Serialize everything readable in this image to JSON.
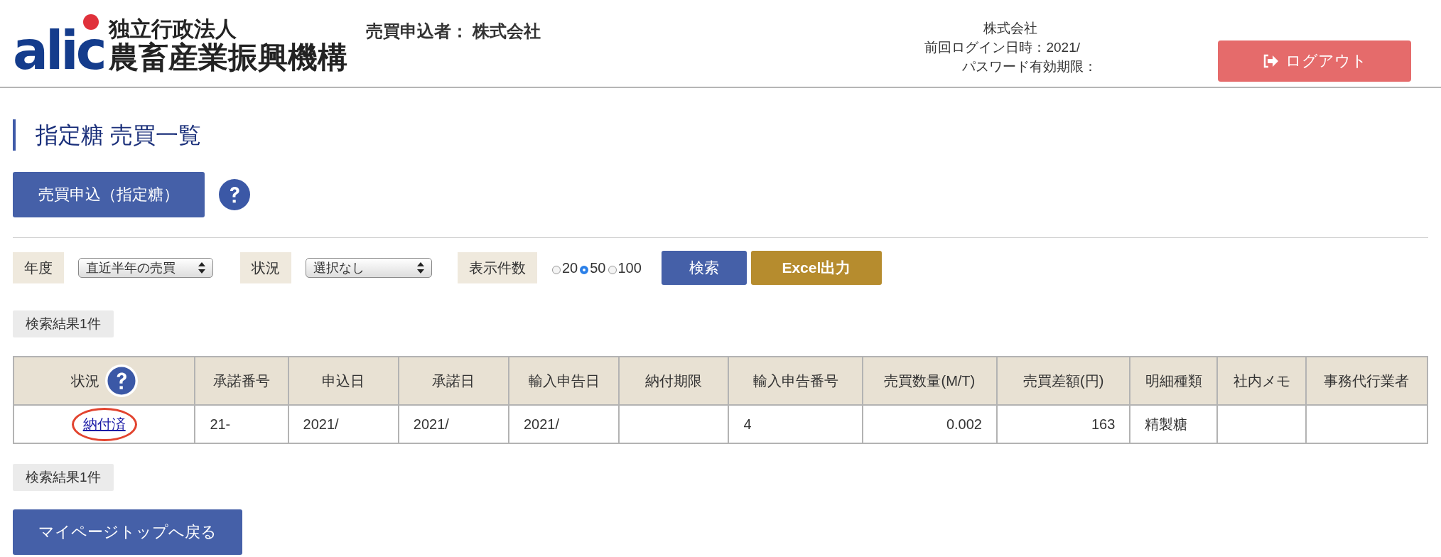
{
  "header": {
    "logo": {
      "mark": "alic",
      "line1": "独立行政法人",
      "line2": "農畜産業振興機構"
    },
    "applicant_label": "売買申込者：",
    "applicant_name": "株式会社",
    "company": "株式会社",
    "last_login": "前回ログイン日時：2021/",
    "password_expiry": "パスワード有効期限：",
    "logout_button": "ログアウト"
  },
  "page_title": "指定糖 売買一覧",
  "apply_button": "売買申込（指定糖）",
  "filters": {
    "year_label": "年度",
    "year_value": "直近半年の売買",
    "status_label": "状況",
    "status_value": "選択なし",
    "count_label": "表示件数",
    "count_options": [
      {
        "label": "20",
        "selected": false
      },
      {
        "label": "50",
        "selected": true
      },
      {
        "label": "100",
        "selected": false
      }
    ],
    "search_button": "検索",
    "excel_button": "Excel出力"
  },
  "result_count_top": "検索結果1件",
  "table": {
    "columns": [
      "状況",
      "承諾番号",
      "申込日",
      "承諾日",
      "輸入申告日",
      "納付期限",
      "輸入申告番号",
      "売買数量(M/T)",
      "売買差額(円)",
      "明細種類",
      "社内メモ",
      "事務代行業者"
    ],
    "rows": [
      {
        "status_circled": true,
        "cells": [
          "納付済",
          "21-",
          "2021/",
          "2021/",
          "2021/",
          "",
          "4",
          "0.002",
          "163",
          "精製糖",
          "",
          ""
        ]
      }
    ]
  },
  "result_count_bottom": "検索結果1件",
  "back_button": "マイページトップへ戻る"
}
